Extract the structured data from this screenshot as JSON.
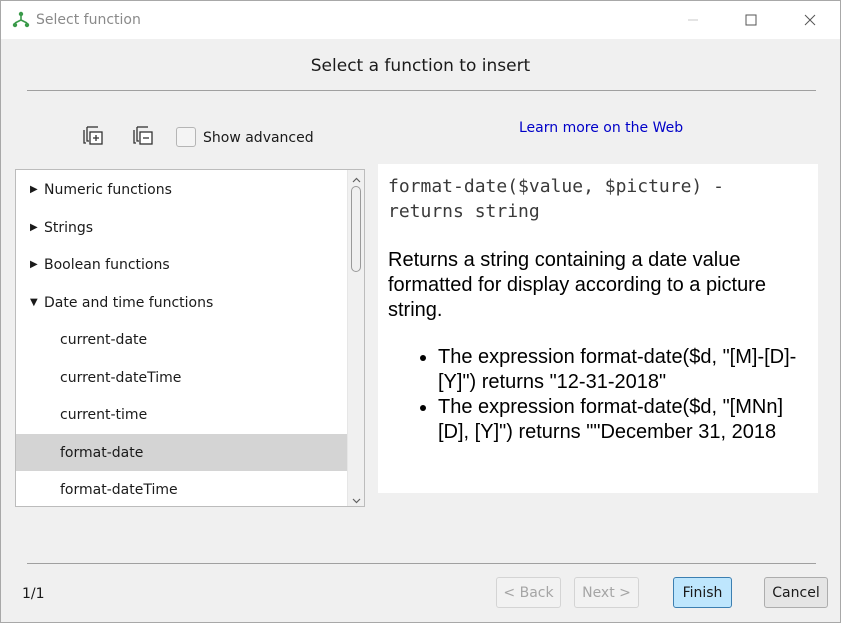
{
  "window": {
    "title": "Select function",
    "app_icon": "workflow-icon",
    "controls": [
      "minimize-icon",
      "maximize-icon",
      "close-icon"
    ]
  },
  "header": {
    "title": "Select a function to insert"
  },
  "toolbar": {
    "expand_all_icon": "expand-all-icon",
    "collapse_all_icon": "collapse-all-icon",
    "show_advanced_label": "Show advanced",
    "show_advanced_checked": false,
    "learn_more_link": "Learn more on the Web"
  },
  "tree": {
    "items": [
      {
        "label": "Numeric functions",
        "level": 0,
        "expanded": false
      },
      {
        "label": "Strings",
        "level": 0,
        "expanded": false
      },
      {
        "label": "Boolean functions",
        "level": 0,
        "expanded": false
      },
      {
        "label": "Date and time functions",
        "level": 0,
        "expanded": true
      },
      {
        "label": "current-date",
        "level": 1
      },
      {
        "label": "current-dateTime",
        "level": 1
      },
      {
        "label": "current-time",
        "level": 1
      },
      {
        "label": "format-date",
        "level": 1,
        "selected": true
      },
      {
        "label": "format-dateTime",
        "level": 1
      }
    ]
  },
  "description": {
    "signature": "format-date($value, $picture) - returns string",
    "text": "Returns a string containing a date value formatted for display according to a picture string.",
    "examples": [
      "The expression format-date($d, \"[M]-[D]-[Y]\") returns \"12-31-2018\"",
      "The expression format-date($d, \"[MNn] [D], [Y]\") returns \"\"December 31, 2018"
    ]
  },
  "footer": {
    "page_indicator": "1/1",
    "back_label": "< Back",
    "next_label": "Next >",
    "finish_label": "Finish",
    "cancel_label": "Cancel"
  },
  "colors": {
    "selection": "#d4d4d4",
    "link": "#0000c8",
    "primary_button_bg": "#bee6fd",
    "primary_button_border": "#3c7fb1"
  }
}
